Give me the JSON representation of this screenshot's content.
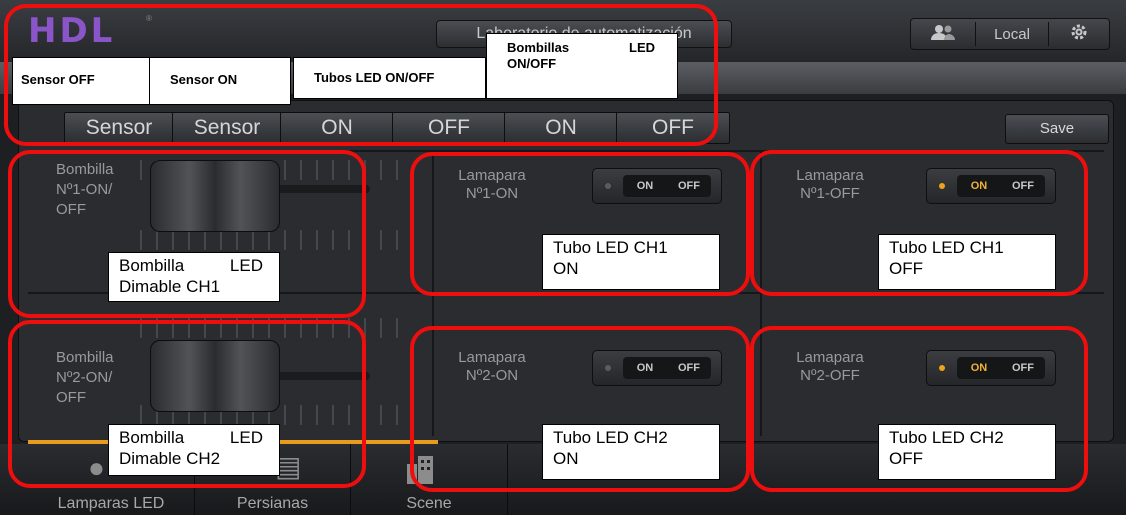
{
  "topbar": {
    "logo": "HDL",
    "title": "Laboratorio de automatización",
    "local": "Local",
    "icons": [
      "users-icon",
      "gear-icon"
    ]
  },
  "scene_bar": {
    "buttons": [
      "Sensor",
      "Sensor",
      "ON",
      "OFF",
      "ON",
      "OFF"
    ],
    "save": "Save"
  },
  "dimmers": [
    {
      "label_lines": [
        "Bombilla",
        "Nº1-ON/",
        "OFF"
      ]
    },
    {
      "label_lines": [
        "Bombilla",
        "Nº2-ON/",
        "OFF"
      ]
    }
  ],
  "lamps": [
    {
      "label_lines": [
        "Lamapara",
        "Nº1-ON"
      ],
      "on": "ON",
      "off": "OFF",
      "state": "off"
    },
    {
      "label_lines": [
        "Lamapara",
        "Nº1-OFF"
      ],
      "on": "ON",
      "off": "OFF",
      "state": "on"
    },
    {
      "label_lines": [
        "Lamapara",
        "Nº2-ON"
      ],
      "on": "ON",
      "off": "OFF",
      "state": "off"
    },
    {
      "label_lines": [
        "Lamapara",
        "Nº2-OFF"
      ],
      "on": "ON",
      "off": "OFF",
      "state": "on"
    }
  ],
  "bottom_nav": [
    "Lamparas LED",
    "Persianas",
    "Scene"
  ],
  "annotations": {
    "sensor_off": "Sensor OFF",
    "sensor_on": "Sensor ON",
    "tubos_led": "Tubos LED ON/OFF",
    "bombillas_led": [
      "Bombillas",
      "LED",
      "ON/OFF"
    ],
    "bombilla_ch1": [
      "Bombilla",
      "LED",
      "Dimable CH1"
    ],
    "bombilla_ch2": [
      "Bombilla",
      "LED",
      "Dimable CH2"
    ],
    "tubo_ch1_on": [
      "Tubo LED CH1",
      "ON"
    ],
    "tubo_ch1_off": [
      "Tubo LED CH1",
      "OFF"
    ],
    "tubo_ch2_on": [
      "Tubo LED CH2",
      "ON"
    ],
    "tubo_ch2_off": [
      "Tubo LED CH2",
      "OFF"
    ]
  },
  "colors": {
    "accent_orange": "#e79c1e",
    "annotation_red": "#ef0e0e",
    "logo_purple": "#8a55c8"
  }
}
